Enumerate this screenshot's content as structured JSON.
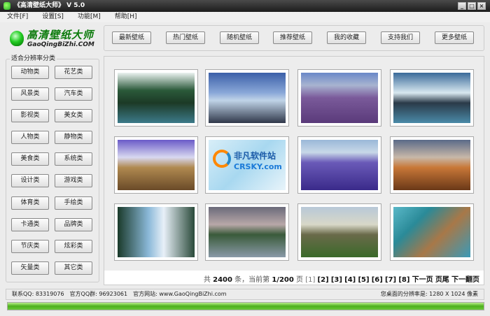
{
  "window": {
    "title": "《高清壁纸大师》 V 5.0",
    "min": "_",
    "max": "□",
    "close": "×"
  },
  "menu": [
    "文件[F]",
    "设置[S]",
    "功能[M]",
    "帮助[H]"
  ],
  "logo": {
    "cn": "高清壁纸大师",
    "en": "GaoQingBiZhi.COM"
  },
  "categories": {
    "label": "适合分辨率分类",
    "items": [
      "动物类",
      "花艺类",
      "风景类",
      "汽车类",
      "影视类",
      "美女类",
      "人物类",
      "静物类",
      "美食类",
      "系统类",
      "设计类",
      "游戏类",
      "体育类",
      "手绘类",
      "卡通类",
      "品牌类",
      "节庆类",
      "炫彩类",
      "矢量类",
      "其它类"
    ]
  },
  "toolbar": [
    "最新壁纸",
    "热门壁纸",
    "随机壁纸",
    "推荐壁纸",
    "我的收藏",
    "支持我们",
    "更多壁纸"
  ],
  "thumbnails": [
    {
      "name": "tropical-lagoon",
      "bg": "linear-gradient(#eaf2f0 0%,#2b5a3a 35%,#1c3a26 60%,#3c7a8a 100%)"
    },
    {
      "name": "canoe-lake",
      "bg": "linear-gradient(#3b5fa8 0%,#8aa8d8 40%,#c0d4e8 55%,#30384a 100%)"
    },
    {
      "name": "lavender-tree",
      "bg": "linear-gradient(#6a88c8 0%,#a8b4d0 25%,#7a5a9a 50%,#5a3a7a 100%)"
    },
    {
      "name": "ocean-waves",
      "bg": "linear-gradient(#3a6a9a 0%,#d8e8f0 40%,#2a3a48 60%,#4a8aa8 100%)"
    },
    {
      "name": "snowy-field",
      "bg": "linear-gradient(#6a5ac8 0%,#d8d8f0 35%,#b08a50 55%,#6a4a28 100%)"
    },
    {
      "name": "crsky-watermark",
      "bg": "linear-gradient(135deg,#d8eef8,#a8d8f0 50%,#e8f4fa)"
    },
    {
      "name": "lupine-field",
      "bg": "linear-gradient(#9ab8d8 0%,#c8d8e8 25%,#6a5ab8 45%,#3a2a8a 100%)"
    },
    {
      "name": "desert-mesa",
      "bg": "linear-gradient(#5a6a88 0%,#c8b8a8 35%,#c87838 55%,#6a3818 100%)"
    },
    {
      "name": "waterfall",
      "bg": "linear-gradient(90deg,#1a3a2a 0%,#8ab8d8 40%,#e8f0f8 60%,#2a4a3a 100%)"
    },
    {
      "name": "mountain-lake",
      "bg": "linear-gradient(#6a6a7a 0%,#b8a8a8 35%,#3a5a3a 55%,#8a9aa8 100%)"
    },
    {
      "name": "lone-tree",
      "bg": "linear-gradient(#b8c8d8 0%,#d8d8c8 35%,#6a6a4a 55%,#3a6a2a 100%)"
    },
    {
      "name": "river-delta",
      "bg": "linear-gradient(135deg,#5ab8c8 0%,#2a8a98 30%,#a87848 60%,#3a9ab8 100%)"
    }
  ],
  "watermark": {
    "cn": "非凡软件站",
    "en": "CRSKY.com"
  },
  "pager": {
    "total_prefix": "共",
    "total": "2400",
    "total_suffix": "条，当前第",
    "page": "1/200",
    "page_suffix": "页",
    "current": "[1]",
    "pages": [
      "[2]",
      "[3]",
      "[4]",
      "[5]",
      "[6]",
      "[7]",
      "[8]"
    ],
    "next": "下一页",
    "last": "页尾",
    "next_group": "下一翻页"
  },
  "status": {
    "qq": "联系QQ: 83319076",
    "group": "官方QQ群: 96923061",
    "site": "官方网站: www.GaoQingBiZhi.com",
    "resolution": "您桌面的分辨率是: 1280 X 1024 像素"
  },
  "progress": {
    "value": 1.0
  }
}
